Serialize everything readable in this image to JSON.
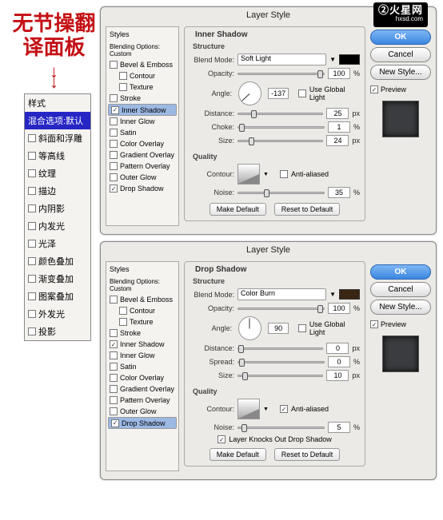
{
  "brand": {
    "name": "②火星网",
    "domain": "hxsd.com"
  },
  "red_heading": "无节操翻译面板",
  "arrow": "↓",
  "dialogs": [
    {
      "title": "Layer Style",
      "styles_header": "Styles",
      "blending": "Blending Options: Custom",
      "effects": [
        {
          "label": "Bevel & Emboss",
          "checked": false
        },
        {
          "label": "Contour",
          "checked": false,
          "indent": true
        },
        {
          "label": "Texture",
          "checked": false,
          "indent": true
        },
        {
          "label": "Stroke",
          "checked": false
        },
        {
          "label": "Inner Shadow",
          "checked": true,
          "selected": true
        },
        {
          "label": "Inner Glow",
          "checked": false
        },
        {
          "label": "Satin",
          "checked": false
        },
        {
          "label": "Color Overlay",
          "checked": false
        },
        {
          "label": "Gradient Overlay",
          "checked": false
        },
        {
          "label": "Pattern Overlay",
          "checked": false
        },
        {
          "label": "Outer Glow",
          "checked": false
        },
        {
          "label": "Drop Shadow",
          "checked": true
        }
      ],
      "panel": {
        "heading": "Inner Shadow",
        "structure": "Structure",
        "blend_label": "Blend Mode:",
        "blend_mode": "Soft Light",
        "opacity_label": "Opacity:",
        "opacity": "100",
        "opacity_suffix": "%",
        "angle_label": "Angle:",
        "angle": "-137",
        "global": "Use Global Light",
        "global_on": false,
        "dist_label": "Distance:",
        "dist": "25",
        "px": "px",
        "choke_label": "Choke:",
        "choke": "1",
        "pct": "%",
        "size_label": "Size:",
        "size": "24",
        "quality": "Quality",
        "contour_label": "Contour:",
        "aa": "Anti-aliased",
        "aa_on": false,
        "noise_label": "Noise:",
        "noise": "35",
        "make_default": "Make Default",
        "reset": "Reset to Default",
        "knockout": null,
        "swatch": "black"
      },
      "buttons": {
        "ok": "OK",
        "cancel": "Cancel",
        "newstyle": "New Style...",
        "preview": "Preview",
        "preview_on": true
      }
    },
    {
      "title": "Layer Style",
      "styles_header": "Styles",
      "blending": "Blending Options: Custom",
      "effects": [
        {
          "label": "Bevel & Emboss",
          "checked": false
        },
        {
          "label": "Contour",
          "checked": false,
          "indent": true
        },
        {
          "label": "Texture",
          "checked": false,
          "indent": true
        },
        {
          "label": "Stroke",
          "checked": false
        },
        {
          "label": "Inner Shadow",
          "checked": true
        },
        {
          "label": "Inner Glow",
          "checked": false
        },
        {
          "label": "Satin",
          "checked": false
        },
        {
          "label": "Color Overlay",
          "checked": false
        },
        {
          "label": "Gradient Overlay",
          "checked": false
        },
        {
          "label": "Pattern Overlay",
          "checked": false
        },
        {
          "label": "Outer Glow",
          "checked": false
        },
        {
          "label": "Drop Shadow",
          "checked": true,
          "selected": true
        }
      ],
      "panel": {
        "heading": "Drop Shadow",
        "structure": "Structure",
        "blend_label": "Blend Mode:",
        "blend_mode": "Color Burn",
        "opacity_label": "Opacity:",
        "opacity": "100",
        "opacity_suffix": "%",
        "angle_label": "Angle:",
        "angle": "90",
        "global": "Use Global Light",
        "global_on": false,
        "dist_label": "Distance:",
        "dist": "0",
        "px": "px",
        "choke_label": "Spread:",
        "choke": "0",
        "pct": "%",
        "size_label": "Size:",
        "size": "10",
        "quality": "Quality",
        "contour_label": "Contour:",
        "aa": "Anti-aliased",
        "aa_on": true,
        "noise_label": "Noise:",
        "noise": "5",
        "knockout": "Layer Knocks Out Drop Shadow",
        "knockout_on": true,
        "make_default": "Make Default",
        "reset": "Reset to Default",
        "swatch": "brown"
      },
      "buttons": {
        "ok": "OK",
        "cancel": "Cancel",
        "newstyle": "New Style...",
        "preview": "Preview",
        "preview_on": true
      }
    }
  ],
  "cn_panel": {
    "head": "样式",
    "blend": "混合选项:默认",
    "items": [
      {
        "label": "斜面和浮雕",
        "checked": false
      },
      {
        "label": "等高线",
        "checked": false,
        "indent": true
      },
      {
        "label": "纹理",
        "checked": false,
        "indent": true
      },
      {
        "label": "描边",
        "checked": false
      },
      {
        "label": "内阴影",
        "checked": false
      },
      {
        "label": "内发光",
        "checked": false
      },
      {
        "label": "光泽",
        "checked": false
      },
      {
        "label": "颜色叠加",
        "checked": false
      },
      {
        "label": "渐变叠加",
        "checked": false
      },
      {
        "label": "图案叠加",
        "checked": false
      },
      {
        "label": "外发光",
        "checked": false
      },
      {
        "label": "投影",
        "checked": false
      }
    ]
  }
}
